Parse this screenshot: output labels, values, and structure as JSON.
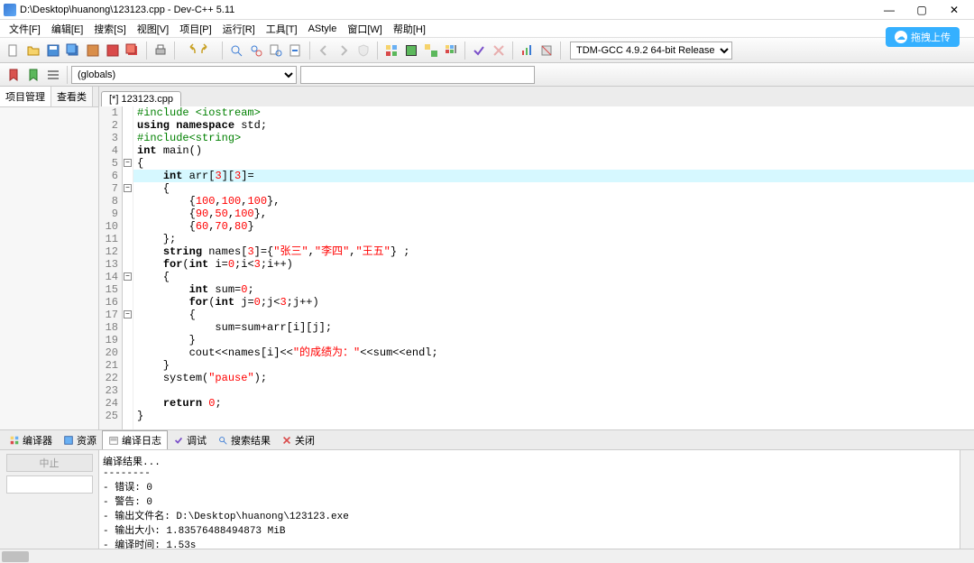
{
  "title": "D:\\Desktop\\huanong\\123123.cpp - Dev-C++ 5.11",
  "window_buttons": {
    "min": "—",
    "max": "▢",
    "close": "✕"
  },
  "menu": [
    "文件[F]",
    "编辑[E]",
    "搜索[S]",
    "视图[V]",
    "项目[P]",
    "运行[R]",
    "工具[T]",
    "AStyle",
    "窗口[W]",
    "帮助[H]"
  ],
  "upload_label": "拖拽上传",
  "globals_combo": "(globals)",
  "compiler_combo": "TDM-GCC 4.9.2 64-bit Release",
  "side_tabs": [
    "项目管理",
    "查看类"
  ],
  "file_tab": "[*] 123123.cpp",
  "code_lines": [
    {
      "n": 1,
      "raw": "#include <iostream>",
      "cls": "pp"
    },
    {
      "n": 2,
      "raw": "using namespace std;",
      "cls": ""
    },
    {
      "n": 3,
      "raw": "#include<string>",
      "cls": "pp"
    },
    {
      "n": 4,
      "raw": "int main()",
      "cls": ""
    },
    {
      "n": 5,
      "raw": "{",
      "cls": "",
      "fold": true
    },
    {
      "n": 6,
      "raw": "    int arr[3][3]=",
      "cls": "",
      "hl": true
    },
    {
      "n": 7,
      "raw": "    {",
      "cls": "",
      "fold": true
    },
    {
      "n": 8,
      "raw": "        {100,100,100},",
      "cls": ""
    },
    {
      "n": 9,
      "raw": "        {90,50,100},",
      "cls": ""
    },
    {
      "n": 10,
      "raw": "        {60,70,80}",
      "cls": ""
    },
    {
      "n": 11,
      "raw": "    };",
      "cls": ""
    },
    {
      "n": 12,
      "raw": "    string names[3]={\"张三\",\"李四\",\"王五\"} ;",
      "cls": ""
    },
    {
      "n": 13,
      "raw": "    for(int i=0;i<3;i++)",
      "cls": ""
    },
    {
      "n": 14,
      "raw": "    {",
      "cls": "",
      "fold": true
    },
    {
      "n": 15,
      "raw": "        int sum=0;",
      "cls": ""
    },
    {
      "n": 16,
      "raw": "        for(int j=0;j<3;j++)",
      "cls": ""
    },
    {
      "n": 17,
      "raw": "        {",
      "cls": "",
      "fold": true
    },
    {
      "n": 18,
      "raw": "            sum=sum+arr[i][j];",
      "cls": ""
    },
    {
      "n": 19,
      "raw": "        }",
      "cls": ""
    },
    {
      "n": 20,
      "raw": "        cout<<names[i]<<\"的成绩为：\"<<sum<<endl;",
      "cls": ""
    },
    {
      "n": 21,
      "raw": "    }",
      "cls": ""
    },
    {
      "n": 22,
      "raw": "    system(\"pause\");",
      "cls": ""
    },
    {
      "n": 23,
      "raw": "",
      "cls": ""
    },
    {
      "n": 24,
      "raw": "    return 0;",
      "cls": ""
    },
    {
      "n": 25,
      "raw": "}",
      "cls": ""
    }
  ],
  "bottom_tabs": [
    "编译器",
    "资源",
    "编译日志",
    "调试",
    "搜索结果",
    "关闭"
  ],
  "bottom_active": 2,
  "stop_btn": "中止",
  "output_header": "编译结果...",
  "output_sep": "--------",
  "output_lines": [
    "- 错误: 0",
    "- 警告: 0",
    "- 输出文件名: D:\\Desktop\\huanong\\123123.exe",
    "- 输出大小: 1.83576488494873 MiB",
    "- 编译时间: 1.53s"
  ],
  "toolbar_icons": {
    "row1": [
      "new",
      "open",
      "save",
      "saveall",
      "saveas",
      "close",
      "closeall",
      "print",
      "undo",
      "redo",
      "find",
      "replace",
      "goto",
      "back",
      "fwd",
      "shield",
      "grid1",
      "grid2",
      "grid3",
      "grid4",
      "check",
      "cross",
      "chart",
      "paint"
    ],
    "row2": [
      "bookmark-add",
      "bookmark-go",
      "bookmark-list"
    ]
  }
}
